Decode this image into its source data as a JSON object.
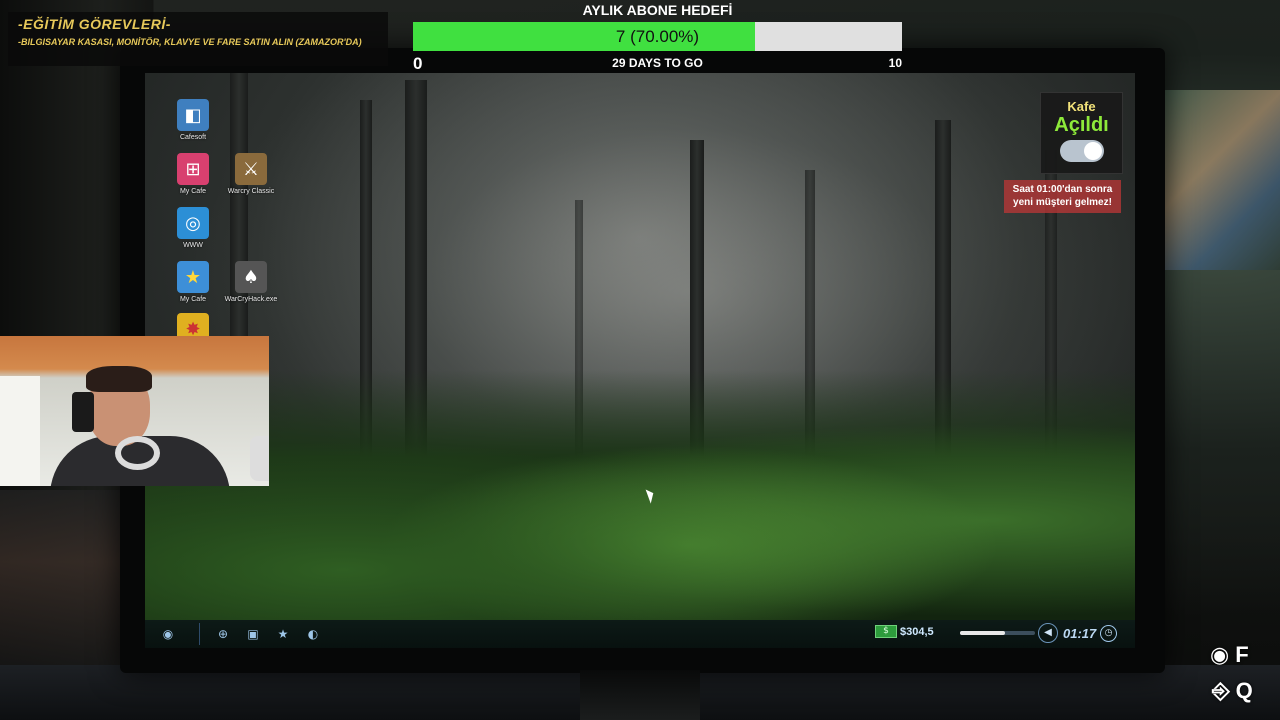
{
  "tasks": {
    "title": "-EĞİTİM GÖREVLERİ-",
    "items": [
      "-BILGISAYAR KASASI, MONİTÖR, KLAVYE VE FARE SATIN ALIN (ZAMAZOR'DA)"
    ]
  },
  "goal": {
    "title": "AYLIK ABONE HEDEFİ",
    "progress_text": "7 (70.00%)",
    "progress_fraction": 0.7,
    "min": "0",
    "max": "10",
    "days_left": "29 DAYS TO GO",
    "fill_color": "#40e040"
  },
  "cafe": {
    "label": "Kafe",
    "state": "Açıldı",
    "toggle_on": true,
    "warning": "Saat 01:00'dan sonra yeni müşteri gelmez!"
  },
  "desktop": {
    "icons": [
      {
        "label": "Cafesoft",
        "icon": "cafesoft-icon",
        "glyph": "◧",
        "color": "#3f7fbf"
      },
      {
        "label": "My Cafe",
        "icon": "my-cafe-network-icon",
        "glyph": "⊞",
        "color": "#d8406f"
      },
      {
        "label": "Warcry Classic",
        "icon": "warcry-classic-icon",
        "glyph": "⚔",
        "color": "#8a6a3c"
      },
      {
        "label": "WWW",
        "icon": "globe-icon",
        "glyph": "◎",
        "color": "#2c8fd6"
      },
      {
        "label": "My Cafe",
        "icon": "my-cafe-star-icon",
        "glyph": "★",
        "color": "#3d8fd8"
      },
      {
        "label": "WarCryHack.exe",
        "icon": "spade-hack-icon",
        "glyph": "♠",
        "color": "#555"
      },
      {
        "label": "",
        "icon": "food-app-icon",
        "glyph": "✸",
        "color": "#e0b020"
      }
    ]
  },
  "taskbar": {
    "start": "start-icon",
    "pinned": [
      "globe-icon",
      "floppy-icon",
      "star-icon",
      "steam-icon"
    ],
    "money": "$304,5",
    "volume_fraction": 0.6,
    "clock": "01:17"
  },
  "hints": [
    {
      "icon": "eye-icon",
      "key": "F"
    },
    {
      "icon": "exit-door-icon",
      "key": "Q"
    }
  ]
}
